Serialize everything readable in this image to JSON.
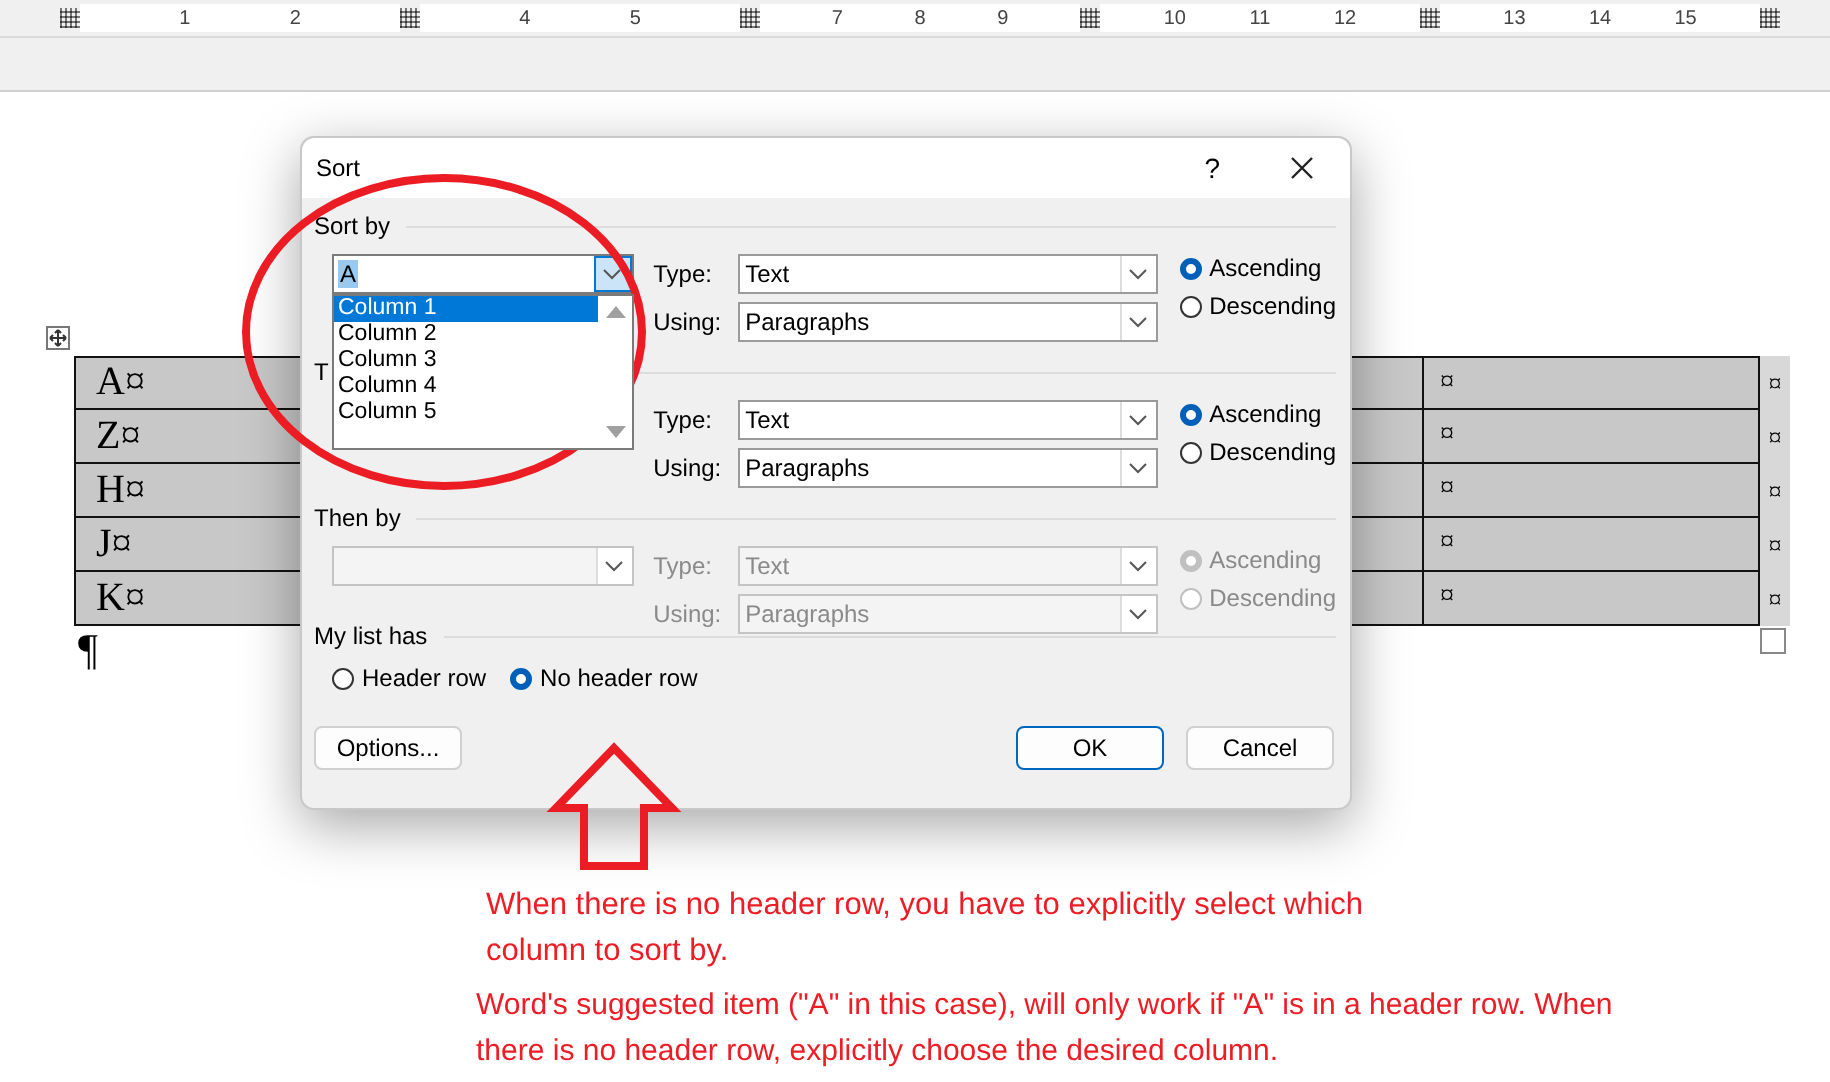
{
  "ruler": {
    "segments": [
      {
        "labels": [
          "1",
          "2"
        ]
      },
      {
        "labels": [
          "4",
          "5"
        ]
      },
      {
        "labels": [
          "7",
          "8",
          "9"
        ]
      },
      {
        "labels": [
          "10",
          "11",
          "12"
        ]
      },
      {
        "labels": [
          "13",
          "14",
          "15"
        ]
      }
    ]
  },
  "table": {
    "rows": [
      {
        "first": "A¤",
        "third": "¤",
        "end": "¤"
      },
      {
        "first": "Z¤",
        "third": "¤",
        "end": "¤"
      },
      {
        "first": "H¤",
        "third": "¤",
        "end": "¤"
      },
      {
        "first": "J¤",
        "third": "¤",
        "end": "¤"
      },
      {
        "first": "K¤",
        "third": "¤",
        "end": "¤"
      }
    ],
    "paragraph_mark": "¶"
  },
  "dialog": {
    "title": "Sort",
    "help": "?",
    "levels": [
      {
        "label": "Sort by",
        "column": "A",
        "disabled": false,
        "list_open": true,
        "type_label": "Type:",
        "type": "Text",
        "using_label": "Using:",
        "using": "Paragraphs",
        "orders": [
          {
            "label": "Ascending",
            "selected": true
          },
          {
            "label": "Descending",
            "selected": false
          }
        ]
      },
      {
        "label": "T",
        "disabled": false,
        "list_open": false,
        "type_label": "Type:",
        "type": "Text",
        "using_label": "Using:",
        "using": "Paragraphs",
        "orders": [
          {
            "label": "Ascending",
            "selected": true
          },
          {
            "label": "Descending",
            "selected": false
          }
        ]
      },
      {
        "label": "Then by",
        "disabled": true,
        "list_open": false,
        "type_label": "Type:",
        "type": "Text",
        "using_label": "Using:",
        "using": "Paragraphs",
        "orders": [
          {
            "label": "Ascending",
            "selected": true
          },
          {
            "label": "Descending",
            "selected": false
          }
        ]
      }
    ],
    "dropdown": {
      "items": [
        {
          "label": "Column 1",
          "selected": true
        },
        {
          "label": "Column 2",
          "selected": false
        },
        {
          "label": "Column 3",
          "selected": false
        },
        {
          "label": "Column 4",
          "selected": false
        },
        {
          "label": "Column 5",
          "selected": false
        }
      ]
    },
    "list_has": {
      "label": "My list has",
      "options": [
        {
          "label": "Header row",
          "selected": false
        },
        {
          "label": "No header row",
          "selected": true
        }
      ]
    },
    "buttons": [
      {
        "label": "Options...",
        "kind": "left"
      },
      {
        "label": "OK",
        "kind": "default"
      },
      {
        "label": "Cancel",
        "kind": "normal"
      }
    ]
  },
  "notes": [
    "When there is no header row, you have to explicitly select which column to sort by.",
    "Word's suggested item (\"A\" in this case), will only work if \"A\" is in a header row. When there is no header row, explicitly choose the desired column."
  ]
}
